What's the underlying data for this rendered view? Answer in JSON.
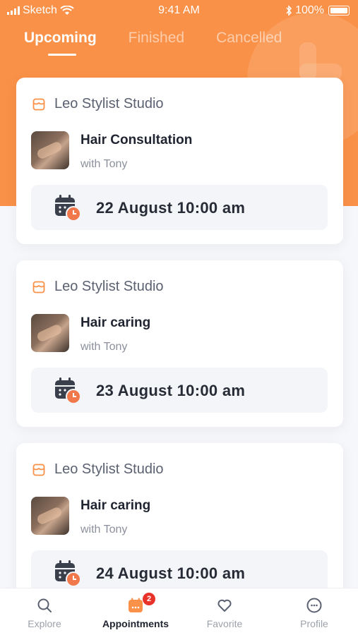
{
  "status_bar": {
    "carrier": "Sketch",
    "time": "9:41 AM",
    "battery": "100%"
  },
  "tabs": [
    {
      "label": "Upcoming"
    },
    {
      "label": "Finished"
    },
    {
      "label": "Cancelled"
    }
  ],
  "appointments": [
    {
      "studio": "Leo Stylist Studio",
      "service": "Hair Consultation",
      "stylist": "with Tony",
      "datetime": "22 August 10:00 am"
    },
    {
      "studio": "Leo Stylist Studio",
      "service": "Hair caring",
      "stylist": "with Tony",
      "datetime": "23 August 10:00 am"
    },
    {
      "studio": "Leo Stylist Studio",
      "service": "Hair caring",
      "stylist": "with Tony",
      "datetime": "24 August 10:00 am"
    }
  ],
  "bottom_nav": {
    "items": [
      {
        "label": "Explore",
        "icon": "search-icon"
      },
      {
        "label": "Appointments",
        "icon": "calendar-icon",
        "badge": "2"
      },
      {
        "label": "Favorite",
        "icon": "heart-icon"
      },
      {
        "label": "Profile",
        "icon": "smiley-icon"
      }
    ]
  },
  "colors": {
    "accent": "#fa9148",
    "badge": "#e8332a",
    "calendar_dark": "#3a3f4c",
    "clock_orange": "#f0784a"
  }
}
